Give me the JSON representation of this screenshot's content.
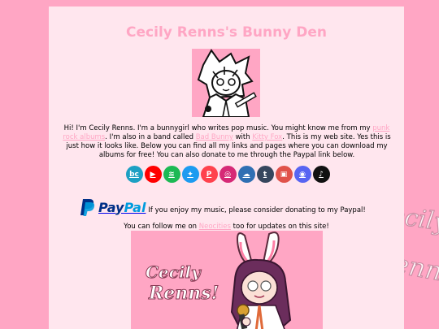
{
  "page": {
    "title": "Cecily Renns's Bunny Den"
  },
  "intro": {
    "part1": "Hi! I'm Cecily Renns. I'm a bunnygirl who writes pop music. You might know me from my ",
    "link1": "punk rock albums",
    "part2": ". I'm also in a band called ",
    "link2": "Bad Bunny",
    "part3": " with ",
    "link3": "Kitty Fox",
    "part4": ". This is my web site. Yes this is just how it looks like. Below you can find all my links and pages where you can download my albums for free! You can also donate to me through the Paypal link below."
  },
  "social_icons": [
    {
      "name": "bandcamp-icon",
      "glyph": "bc",
      "color": "#1da0c3"
    },
    {
      "name": "youtube-icon",
      "glyph": "▶",
      "color": "#ff0000"
    },
    {
      "name": "spotify-icon",
      "glyph": "≋",
      "color": "#1db954"
    },
    {
      "name": "twitter-icon",
      "glyph": "✦",
      "color": "#1d9bf0"
    },
    {
      "name": "patreon-icon",
      "glyph": "P",
      "color": "#ff424d"
    },
    {
      "name": "instagram-icon",
      "glyph": "◎",
      "color": "#d62976"
    },
    {
      "name": "soundcloud-icon",
      "glyph": "☁",
      "color": "#2f6fb3"
    },
    {
      "name": "tumblr-icon",
      "glyph": "t",
      "color": "#36465d"
    },
    {
      "name": "bluesky-icon",
      "glyph": "▣",
      "color": "#e0524a"
    },
    {
      "name": "discord-icon",
      "glyph": "◉",
      "color": "#5865f2"
    },
    {
      "name": "tiktok-icon",
      "glyph": "♪",
      "color": "#111111"
    }
  ],
  "paypal": {
    "logo_text_1": "Pay",
    "logo_text_2": "Pal",
    "note": "If you enjoy my music, please consider donating to my Paypal!"
  },
  "follow": {
    "part1": "You can follow me on ",
    "link": "Neocities",
    "part2": " too for updates on this site!"
  },
  "banner": {
    "logo_line1": "Cecily",
    "logo_line2": "Renns!"
  },
  "watermark": {
    "line1": "Cecily",
    "line2": "Renns"
  },
  "colors": {
    "background": "#ffa6c4",
    "panel": "#ffe6ee",
    "accent": "#ffa6c4",
    "paypal_dark": "#003087",
    "paypal_light": "#009cde"
  }
}
